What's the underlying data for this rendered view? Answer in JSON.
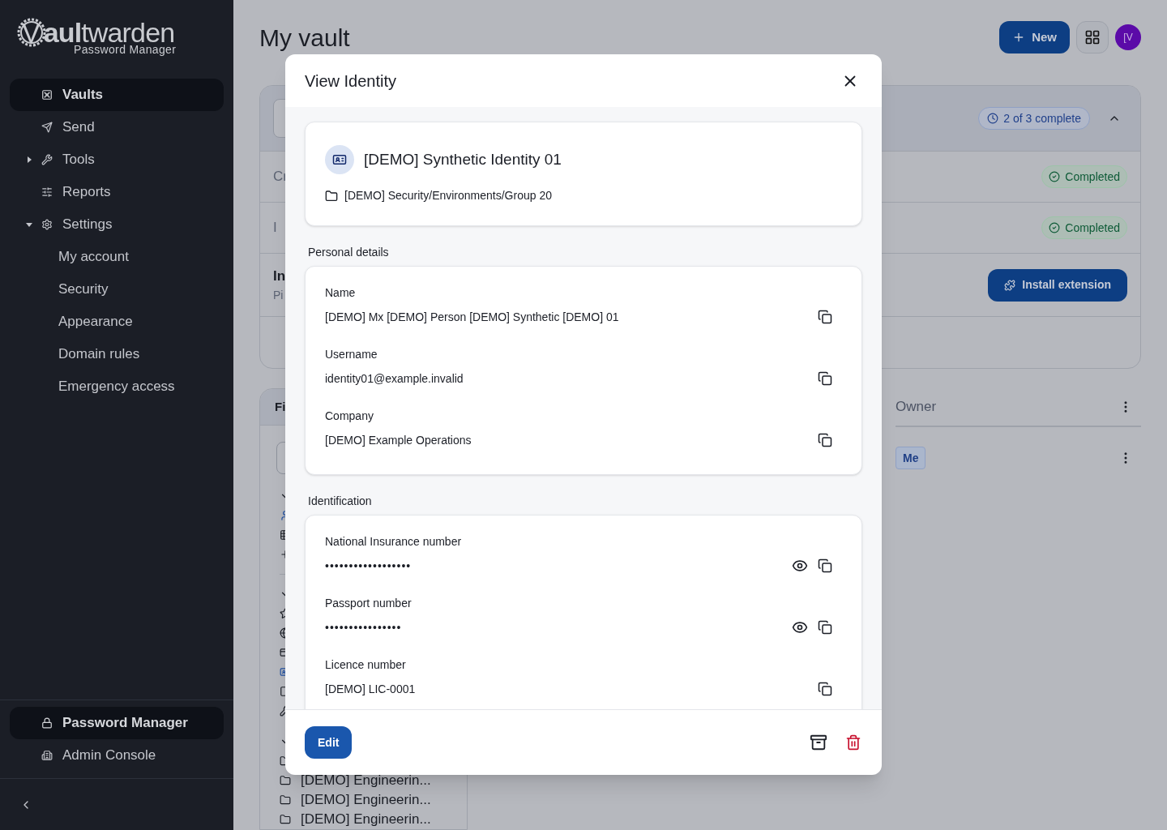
{
  "sidebar": {
    "logo": {
      "wordmark": "Vaultwarden",
      "subtitle": "Password Manager"
    },
    "items": [
      {
        "label": "Vaults",
        "selected": true
      },
      {
        "label": "Send",
        "selected": false
      },
      {
        "label": "Tools",
        "selected": false,
        "expanded": false
      },
      {
        "label": "Reports",
        "selected": false
      },
      {
        "label": "Settings",
        "selected": false,
        "expanded": true,
        "children": [
          {
            "label": "My account",
            "selected": false
          },
          {
            "label": "Security",
            "selected": false
          },
          {
            "label": "Appearance",
            "selected": false
          },
          {
            "label": "Domain rules",
            "selected": false
          },
          {
            "label": "Emergency access",
            "selected": false
          }
        ]
      }
    ],
    "products": [
      {
        "label": "Password Manager",
        "selected": true
      },
      {
        "label": "Admin Console",
        "selected": false
      }
    ]
  },
  "header": {
    "title": "My vault",
    "new_button": "New",
    "avatar": "[V"
  },
  "onboarding": {
    "progress": "2 of 3 complete",
    "expanded": true,
    "tasks": [
      {
        "kind": "badge",
        "title": "Cr",
        "status": "Completed"
      },
      {
        "kind": "badge",
        "title": "I",
        "status": "Completed"
      },
      {
        "kind": "button",
        "title": "In",
        "subtitle": "Pi",
        "action": "Install extension"
      }
    ]
  },
  "filters": {
    "title": "Fi",
    "folders": [
      "[DEMO] Engineerin...",
      "[DEMO] Engineerin...",
      "[DEMO] Engineerin..."
    ]
  },
  "table": {
    "columns": [
      {
        "label": "Owner"
      }
    ],
    "rows": [
      {
        "owner": "Me"
      }
    ]
  },
  "dialog": {
    "title": "View Identity",
    "item": {
      "name": "[DEMO] Synthetic Identity 01",
      "folder": "[DEMO] Security/Environments/Group 20"
    },
    "sections": [
      {
        "heading": "Personal details",
        "fields": [
          {
            "label": "Name",
            "value": "[DEMO] Mx [DEMO] Person [DEMO] Synthetic [DEMO] 01",
            "hidden": false
          },
          {
            "label": "Username",
            "value": "identity01@example.invalid",
            "hidden": false
          },
          {
            "label": "Company",
            "value": "[DEMO] Example Operations",
            "hidden": false
          }
        ]
      },
      {
        "heading": "Identification",
        "fields": [
          {
            "label": "National Insurance number",
            "value": "••••••••••••••••••",
            "hidden": true
          },
          {
            "label": "Passport number",
            "value": "••••••••••••••••",
            "hidden": true
          },
          {
            "label": "Licence number",
            "value": "[DEMO] LIC-0001",
            "hidden": false
          }
        ]
      }
    ],
    "edit_button": "Edit"
  }
}
